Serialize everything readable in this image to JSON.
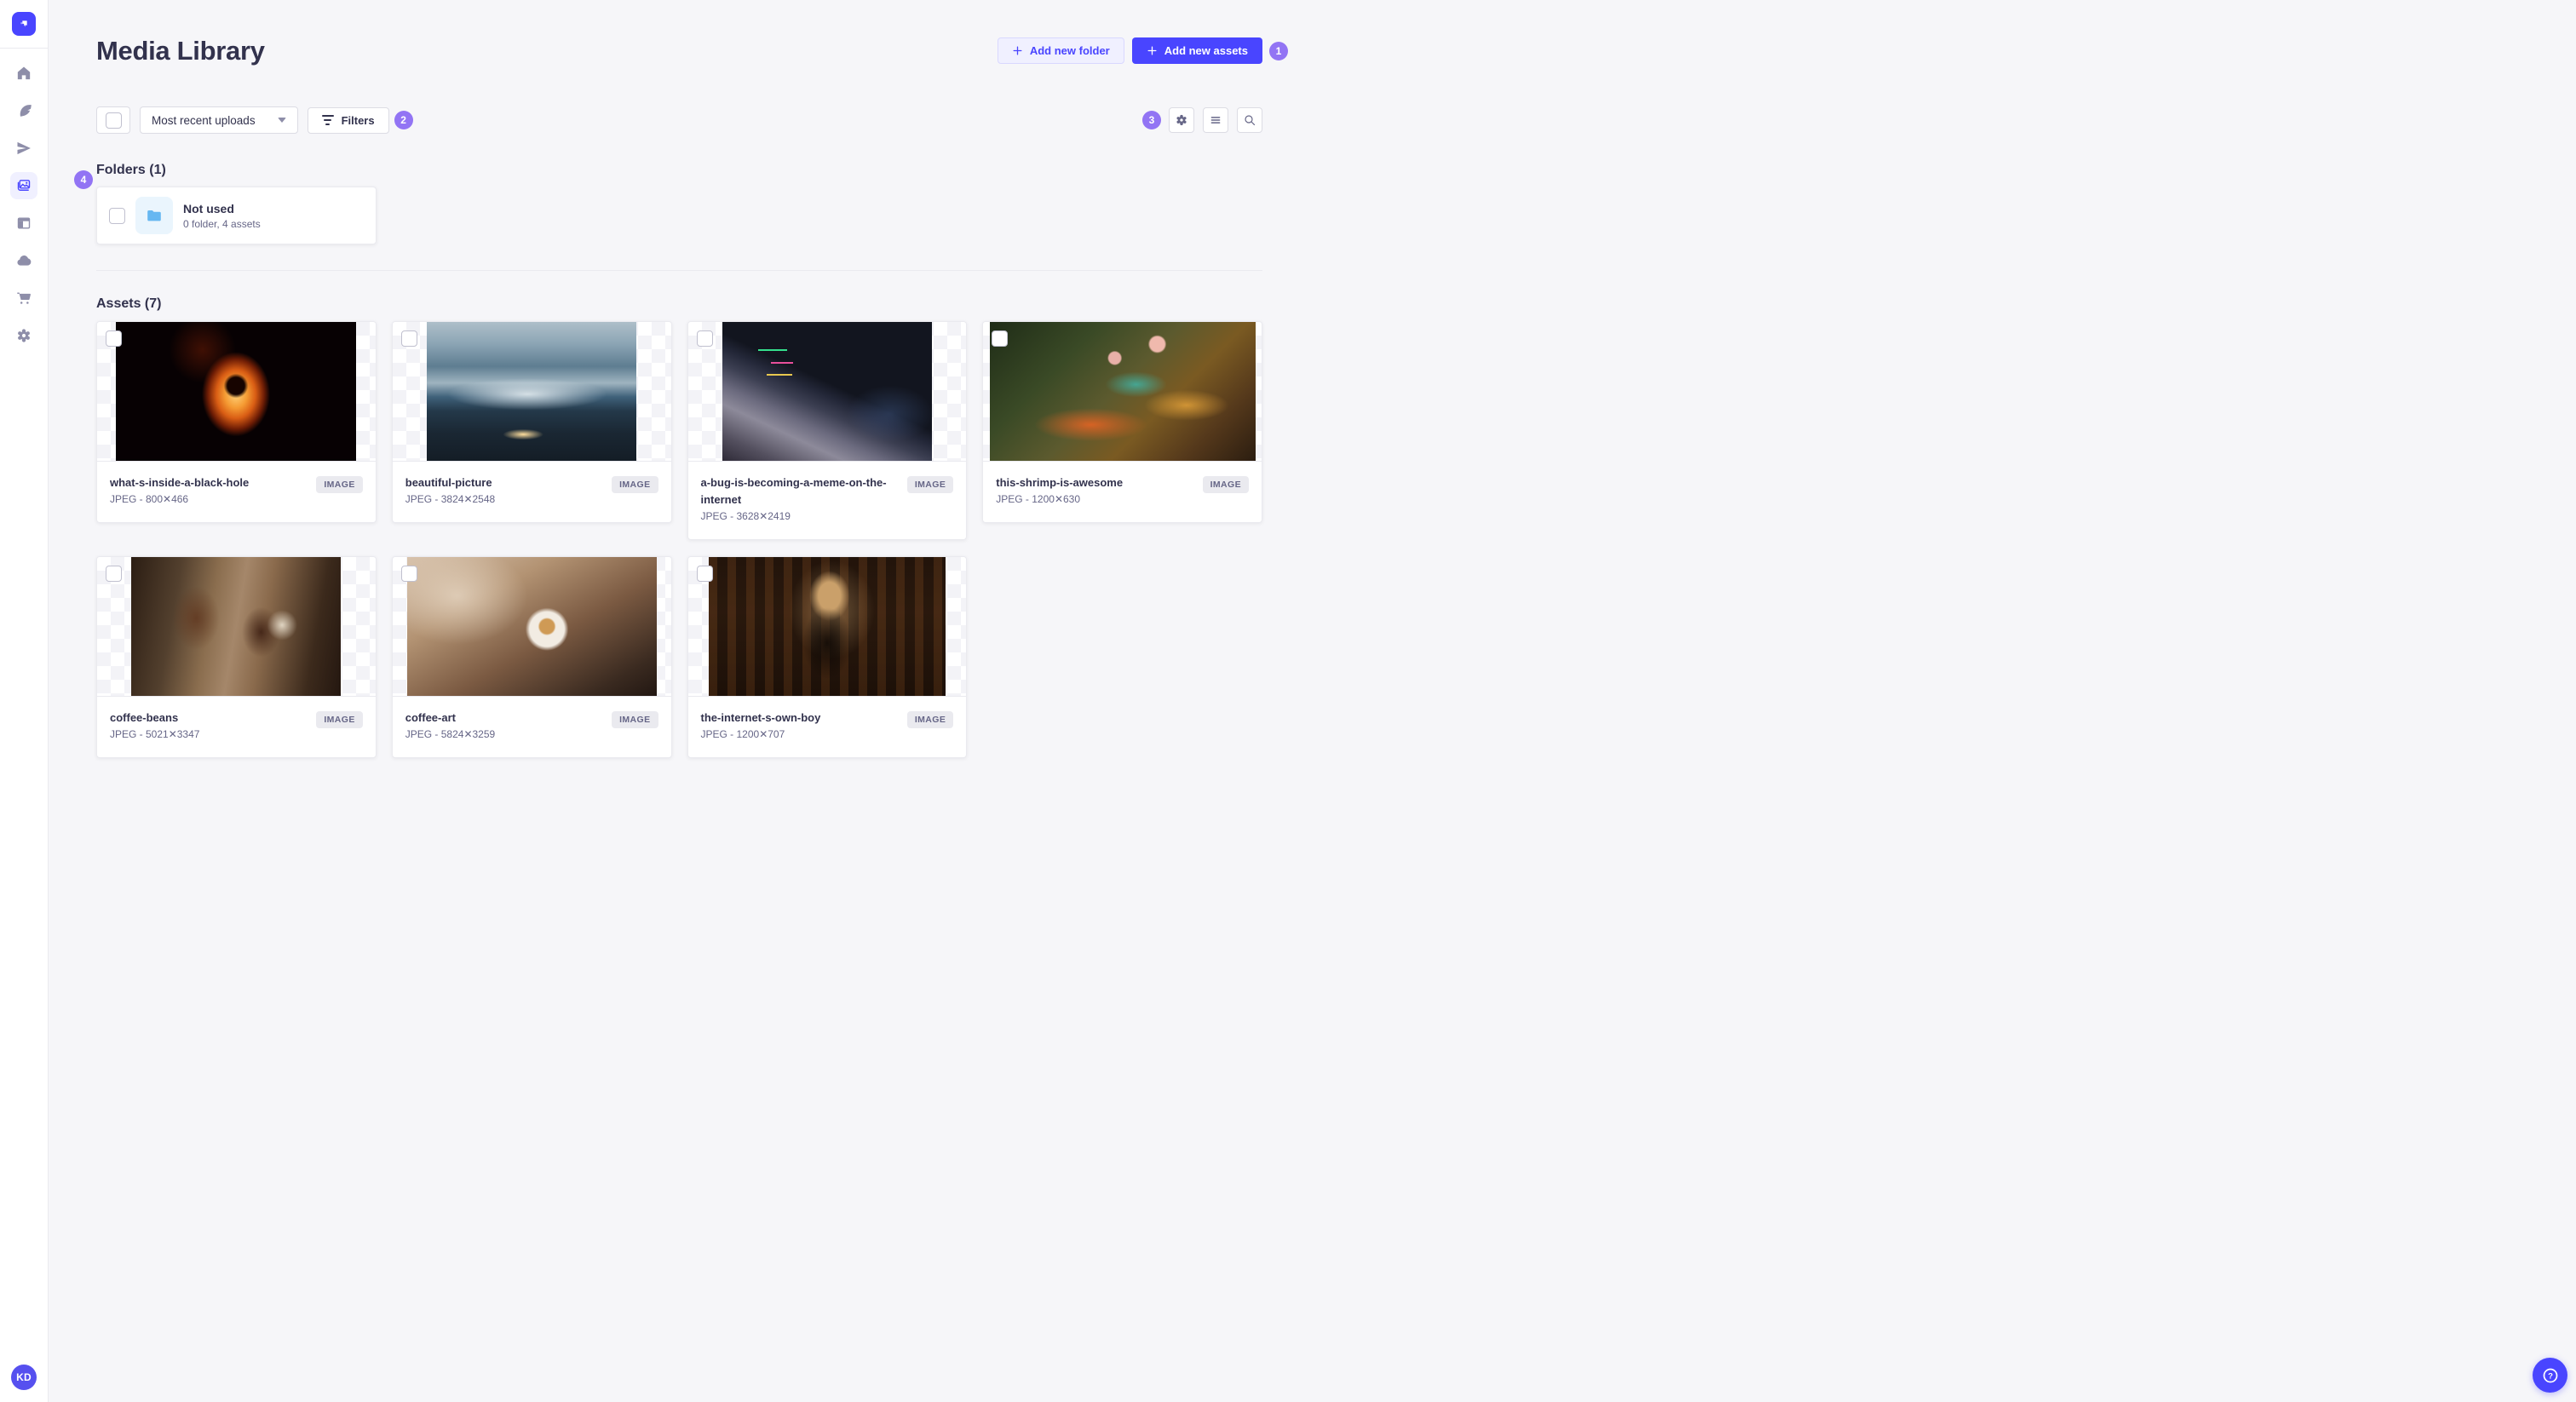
{
  "colors": {
    "primary": "#4945ff",
    "primary_light_bg": "#f0f0ff",
    "primary_border": "#d9d8ff",
    "page_bg": "#f6f6f9",
    "card_border": "#eaeaef",
    "input_border": "#dcdce4",
    "text_strong": "#32324d",
    "text_muted": "#666687",
    "icon_gray": "#8e8ea9",
    "badge_purple": "#9274f4",
    "badge_bg": "#eaeaef",
    "folder_blue": "#66b7f1",
    "folder_blue_bg": "#eaf5fd"
  },
  "sidebar": {
    "icons": [
      "home-icon",
      "feather-icon",
      "send-icon",
      "media-library-icon",
      "layout-icon",
      "cloud-icon",
      "cart-icon",
      "settings-icon"
    ],
    "active_item": "media-library-icon",
    "user_initials": "KD"
  },
  "header": {
    "title": "Media Library",
    "add_folder_label": "Add new folder",
    "add_assets_label": "Add new assets"
  },
  "toolbar": {
    "sort_value": "Most recent uploads",
    "filters_label": "Filters"
  },
  "tour": {
    "step_add_assets": "1",
    "step_filters": "2",
    "step_views": "3",
    "step_folders": "4"
  },
  "folders": {
    "heading": "Folders (1)",
    "items": [
      {
        "name": "Not used",
        "meta": "0 folder, 4 assets"
      }
    ]
  },
  "assets": {
    "heading": "Assets (7)",
    "items": [
      {
        "name": "what-s-inside-a-black-hole",
        "meta": "JPEG - 800✕466",
        "type": "IMAGE"
      },
      {
        "name": "beautiful-picture",
        "meta": "JPEG - 3824✕2548",
        "type": "IMAGE"
      },
      {
        "name": "a-bug-is-becoming-a-meme-on-the-internet",
        "meta": "JPEG - 3628✕2419",
        "type": "IMAGE"
      },
      {
        "name": "this-shrimp-is-awesome",
        "meta": "JPEG - 1200✕630",
        "type": "IMAGE"
      },
      {
        "name": "coffee-beans",
        "meta": "JPEG - 5021✕3347",
        "type": "IMAGE"
      },
      {
        "name": "coffee-art",
        "meta": "JPEG - 5824✕3259",
        "type": "IMAGE"
      },
      {
        "name": "the-internet-s-own-boy",
        "meta": "JPEG - 1200✕707",
        "type": "IMAGE"
      }
    ]
  }
}
